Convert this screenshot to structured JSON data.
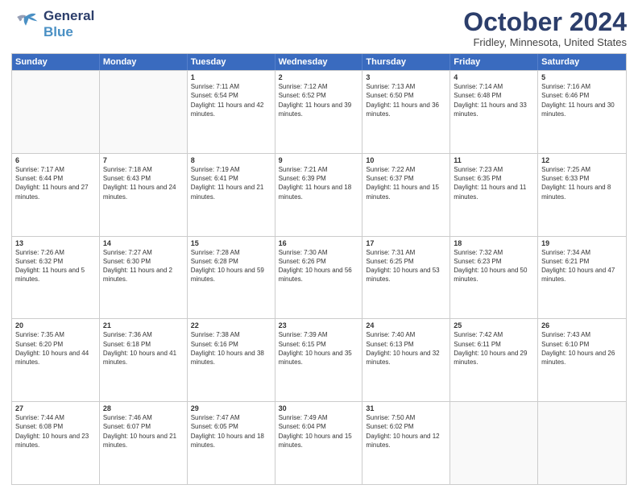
{
  "header": {
    "logo_line1": "General",
    "logo_line2": "Blue",
    "title": "October 2024",
    "subtitle": "Fridley, Minnesota, United States"
  },
  "calendar": {
    "days_of_week": [
      "Sunday",
      "Monday",
      "Tuesday",
      "Wednesday",
      "Thursday",
      "Friday",
      "Saturday"
    ],
    "weeks": [
      [
        {
          "day": "",
          "info": ""
        },
        {
          "day": "",
          "info": ""
        },
        {
          "day": "1",
          "info": "Sunrise: 7:11 AM\nSunset: 6:54 PM\nDaylight: 11 hours and 42 minutes."
        },
        {
          "day": "2",
          "info": "Sunrise: 7:12 AM\nSunset: 6:52 PM\nDaylight: 11 hours and 39 minutes."
        },
        {
          "day": "3",
          "info": "Sunrise: 7:13 AM\nSunset: 6:50 PM\nDaylight: 11 hours and 36 minutes."
        },
        {
          "day": "4",
          "info": "Sunrise: 7:14 AM\nSunset: 6:48 PM\nDaylight: 11 hours and 33 minutes."
        },
        {
          "day": "5",
          "info": "Sunrise: 7:16 AM\nSunset: 6:46 PM\nDaylight: 11 hours and 30 minutes."
        }
      ],
      [
        {
          "day": "6",
          "info": "Sunrise: 7:17 AM\nSunset: 6:44 PM\nDaylight: 11 hours and 27 minutes."
        },
        {
          "day": "7",
          "info": "Sunrise: 7:18 AM\nSunset: 6:43 PM\nDaylight: 11 hours and 24 minutes."
        },
        {
          "day": "8",
          "info": "Sunrise: 7:19 AM\nSunset: 6:41 PM\nDaylight: 11 hours and 21 minutes."
        },
        {
          "day": "9",
          "info": "Sunrise: 7:21 AM\nSunset: 6:39 PM\nDaylight: 11 hours and 18 minutes."
        },
        {
          "day": "10",
          "info": "Sunrise: 7:22 AM\nSunset: 6:37 PM\nDaylight: 11 hours and 15 minutes."
        },
        {
          "day": "11",
          "info": "Sunrise: 7:23 AM\nSunset: 6:35 PM\nDaylight: 11 hours and 11 minutes."
        },
        {
          "day": "12",
          "info": "Sunrise: 7:25 AM\nSunset: 6:33 PM\nDaylight: 11 hours and 8 minutes."
        }
      ],
      [
        {
          "day": "13",
          "info": "Sunrise: 7:26 AM\nSunset: 6:32 PM\nDaylight: 11 hours and 5 minutes."
        },
        {
          "day": "14",
          "info": "Sunrise: 7:27 AM\nSunset: 6:30 PM\nDaylight: 11 hours and 2 minutes."
        },
        {
          "day": "15",
          "info": "Sunrise: 7:28 AM\nSunset: 6:28 PM\nDaylight: 10 hours and 59 minutes."
        },
        {
          "day": "16",
          "info": "Sunrise: 7:30 AM\nSunset: 6:26 PM\nDaylight: 10 hours and 56 minutes."
        },
        {
          "day": "17",
          "info": "Sunrise: 7:31 AM\nSunset: 6:25 PM\nDaylight: 10 hours and 53 minutes."
        },
        {
          "day": "18",
          "info": "Sunrise: 7:32 AM\nSunset: 6:23 PM\nDaylight: 10 hours and 50 minutes."
        },
        {
          "day": "19",
          "info": "Sunrise: 7:34 AM\nSunset: 6:21 PM\nDaylight: 10 hours and 47 minutes."
        }
      ],
      [
        {
          "day": "20",
          "info": "Sunrise: 7:35 AM\nSunset: 6:20 PM\nDaylight: 10 hours and 44 minutes."
        },
        {
          "day": "21",
          "info": "Sunrise: 7:36 AM\nSunset: 6:18 PM\nDaylight: 10 hours and 41 minutes."
        },
        {
          "day": "22",
          "info": "Sunrise: 7:38 AM\nSunset: 6:16 PM\nDaylight: 10 hours and 38 minutes."
        },
        {
          "day": "23",
          "info": "Sunrise: 7:39 AM\nSunset: 6:15 PM\nDaylight: 10 hours and 35 minutes."
        },
        {
          "day": "24",
          "info": "Sunrise: 7:40 AM\nSunset: 6:13 PM\nDaylight: 10 hours and 32 minutes."
        },
        {
          "day": "25",
          "info": "Sunrise: 7:42 AM\nSunset: 6:11 PM\nDaylight: 10 hours and 29 minutes."
        },
        {
          "day": "26",
          "info": "Sunrise: 7:43 AM\nSunset: 6:10 PM\nDaylight: 10 hours and 26 minutes."
        }
      ],
      [
        {
          "day": "27",
          "info": "Sunrise: 7:44 AM\nSunset: 6:08 PM\nDaylight: 10 hours and 23 minutes."
        },
        {
          "day": "28",
          "info": "Sunrise: 7:46 AM\nSunset: 6:07 PM\nDaylight: 10 hours and 21 minutes."
        },
        {
          "day": "29",
          "info": "Sunrise: 7:47 AM\nSunset: 6:05 PM\nDaylight: 10 hours and 18 minutes."
        },
        {
          "day": "30",
          "info": "Sunrise: 7:49 AM\nSunset: 6:04 PM\nDaylight: 10 hours and 15 minutes."
        },
        {
          "day": "31",
          "info": "Sunrise: 7:50 AM\nSunset: 6:02 PM\nDaylight: 10 hours and 12 minutes."
        },
        {
          "day": "",
          "info": ""
        },
        {
          "day": "",
          "info": ""
        }
      ]
    ]
  }
}
